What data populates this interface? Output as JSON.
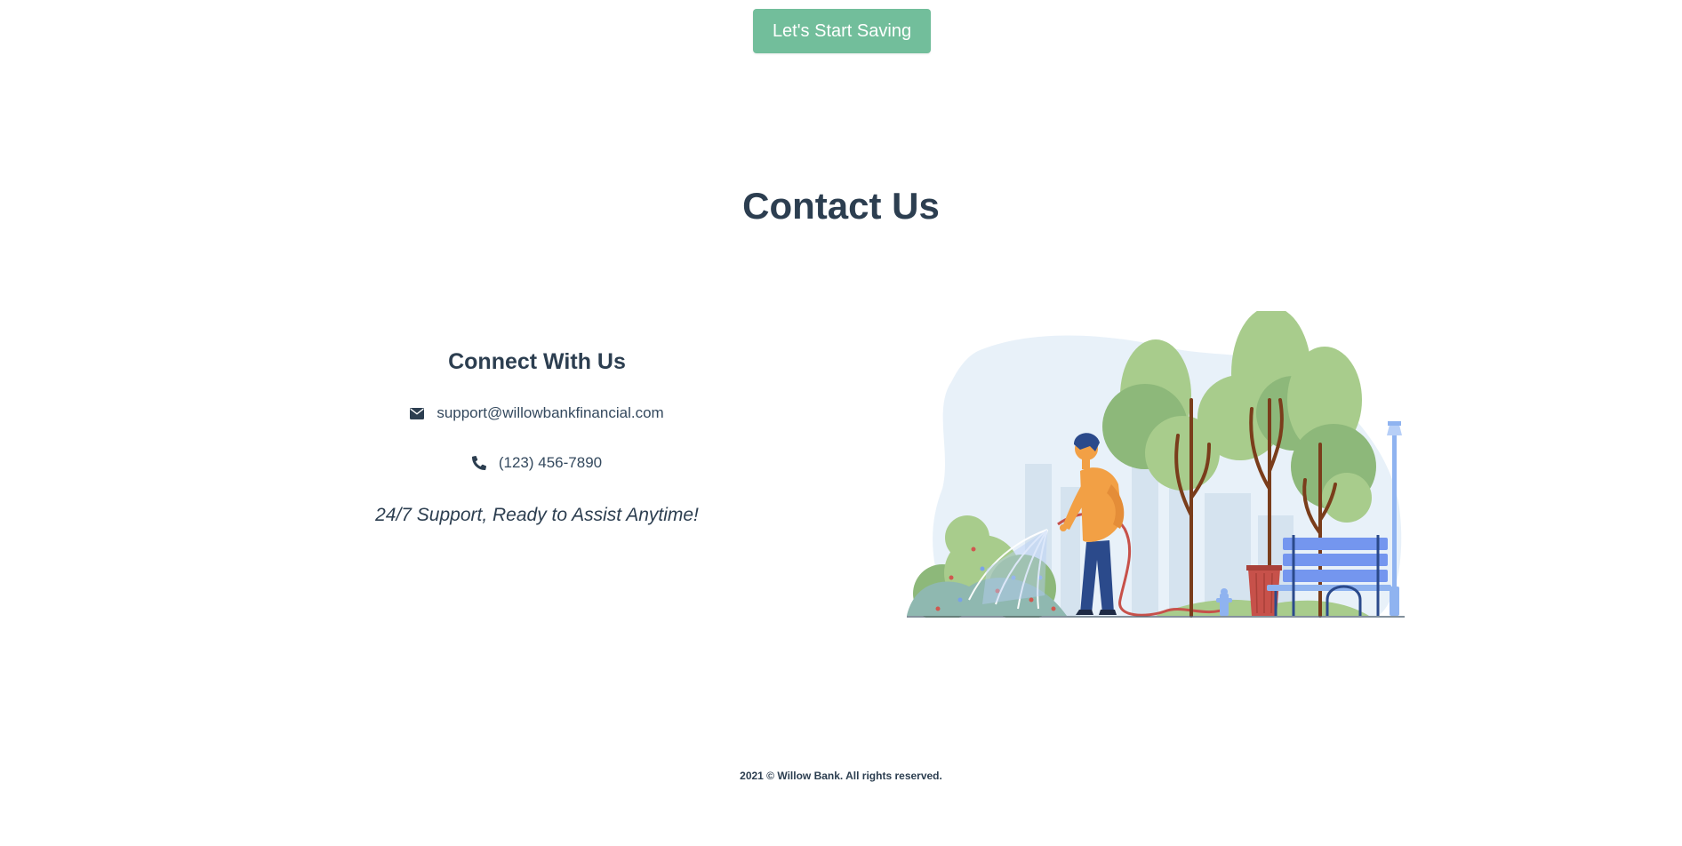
{
  "hero": {
    "cta_label": "Let's Start Saving"
  },
  "contact": {
    "title": "Contact Us",
    "connect_heading": "Connect With Us",
    "email": "support@willowbankfinancial.com",
    "phone": "(123) 456-7890",
    "tagline": "24/7 Support, Ready to Assist Anytime!",
    "email_icon": "envelope-icon",
    "phone_icon": "phone-icon"
  },
  "footer": {
    "copyright": "2021 © Willow Bank. All rights reserved."
  },
  "colors": {
    "accent": "#72be9b",
    "heading": "#2c3e50",
    "text": "#34495e"
  }
}
